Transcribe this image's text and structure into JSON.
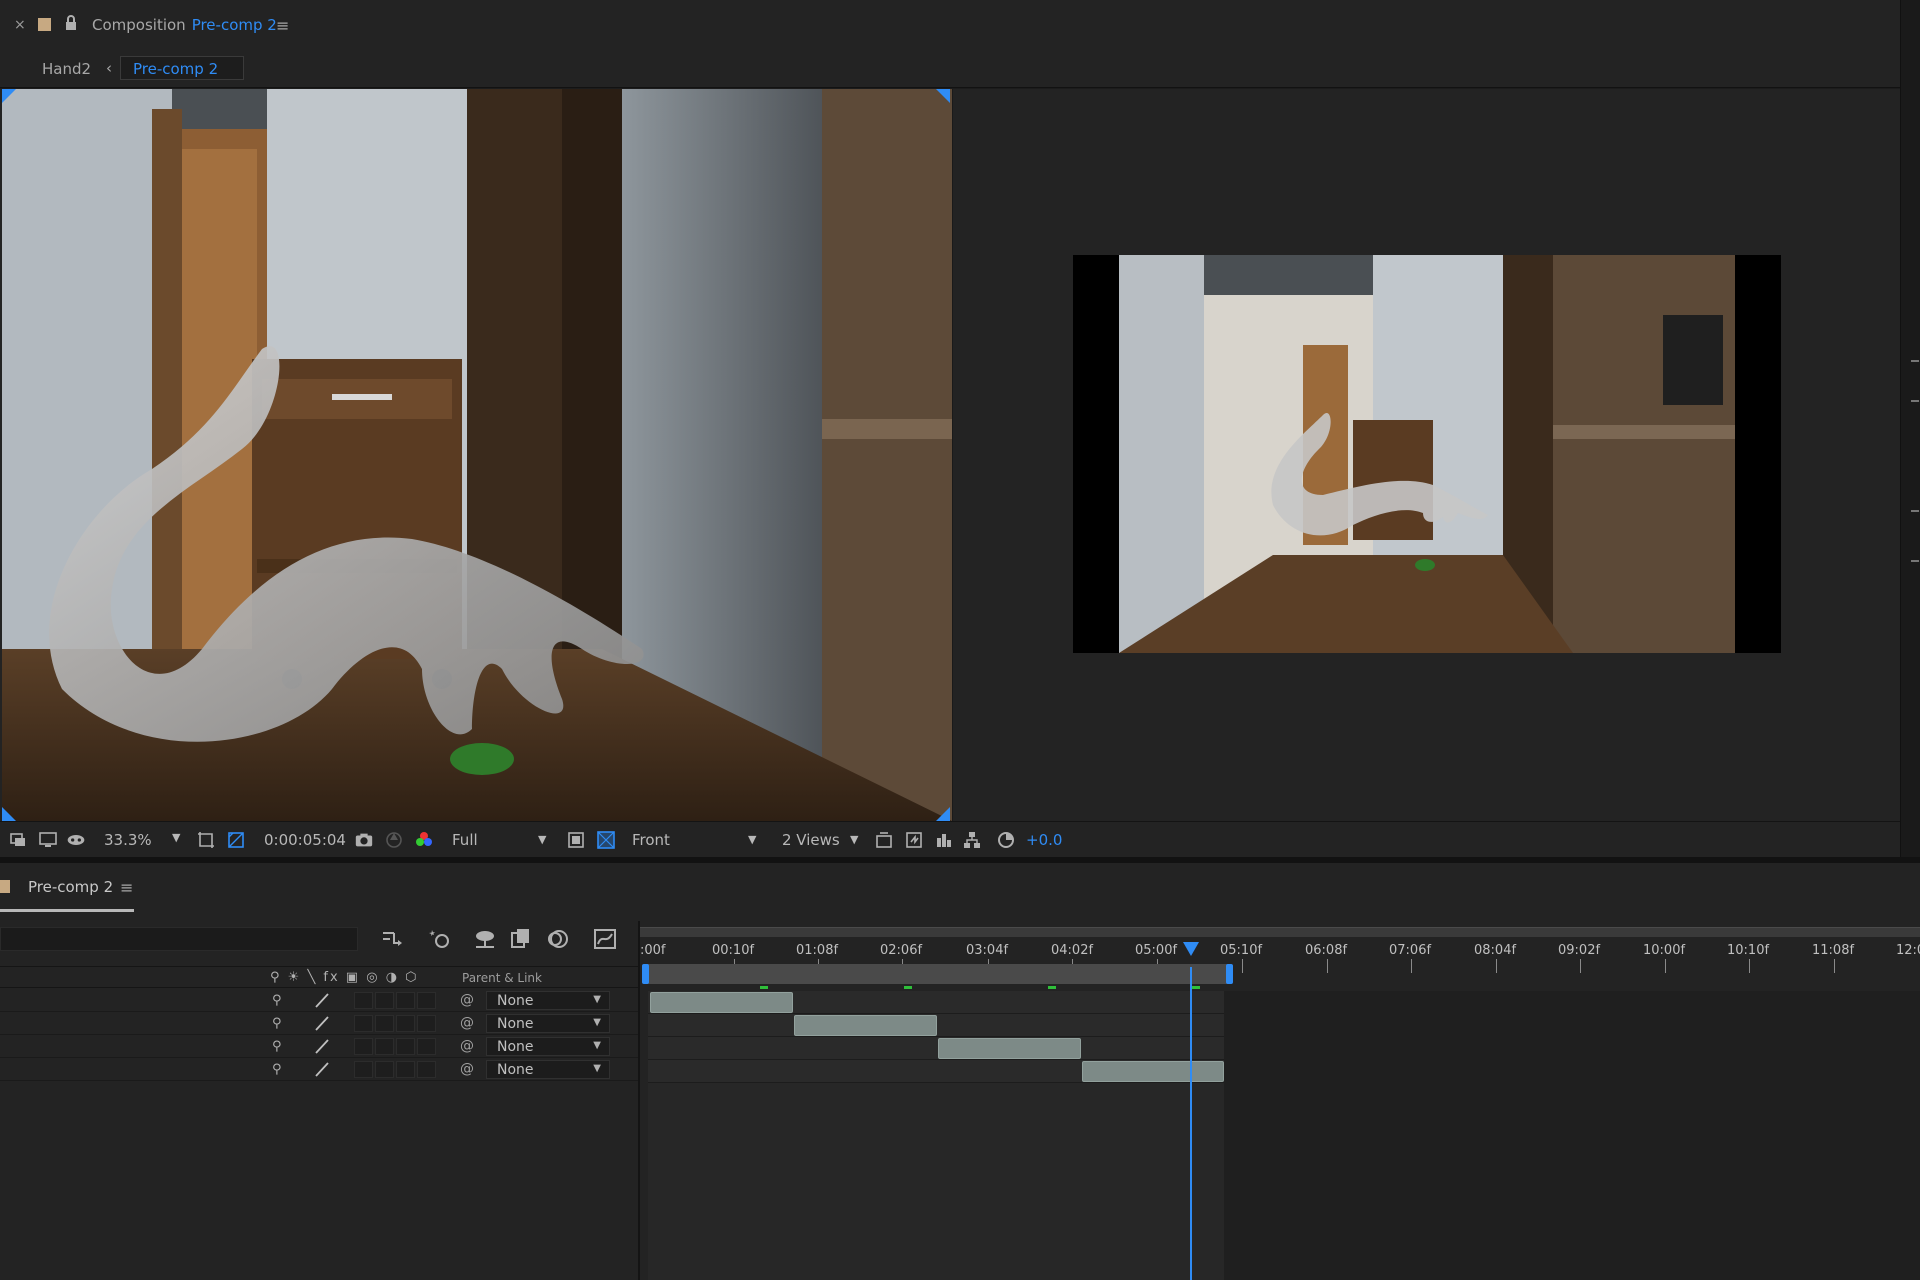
{
  "comp_header": {
    "close": "×",
    "title_prefix": "Composition",
    "comp_name": "Pre-comp 2",
    "menu": "≡"
  },
  "breadcrumb": {
    "parent": "Hand2",
    "chevron": "‹",
    "current": "Pre-comp 2"
  },
  "viewer_toolbar": {
    "zoom": "33.3%",
    "timecode": "0:00:05:04",
    "resolution": "Full",
    "view": "Front",
    "layout": "2 Views",
    "exposure": "+0.0"
  },
  "timeline": {
    "tab_label": "Pre-comp 2",
    "menu": "≡",
    "column_switch_icons": "⚲ ☀ ╲ fx ▣ ◎ ◑ ⬡",
    "parent_link_label": "Parent & Link",
    "ruler_labels": [
      ":00f",
      "00:10f",
      "01:08f",
      "02:06f",
      "03:04f",
      "04:02f",
      "05:00f",
      "05:10f",
      "06:08f",
      "07:06f",
      "08:04f",
      "09:02f",
      "10:00f",
      "10:10f",
      "11:08f",
      "12:0"
    ],
    "layers": [
      {
        "parent": "None"
      },
      {
        "parent": "None"
      },
      {
        "parent": "None"
      },
      {
        "parent": "None"
      }
    ],
    "current_time": "0:00:05:04"
  },
  "colors": {
    "accent": "#2f8cf5",
    "label_swatch": "#c7a982",
    "layer_bar": "#7d8a87",
    "marker_green": "#2fbf3a",
    "panel_bg": "#232323"
  },
  "icons": [
    "lock-icon",
    "camera-snapshot-icon",
    "color-channels-icon",
    "grid-icon",
    "transparency-grid-icon",
    "3d-view-icon",
    "reset-exposure-icon",
    "cti-marker-icon"
  ]
}
